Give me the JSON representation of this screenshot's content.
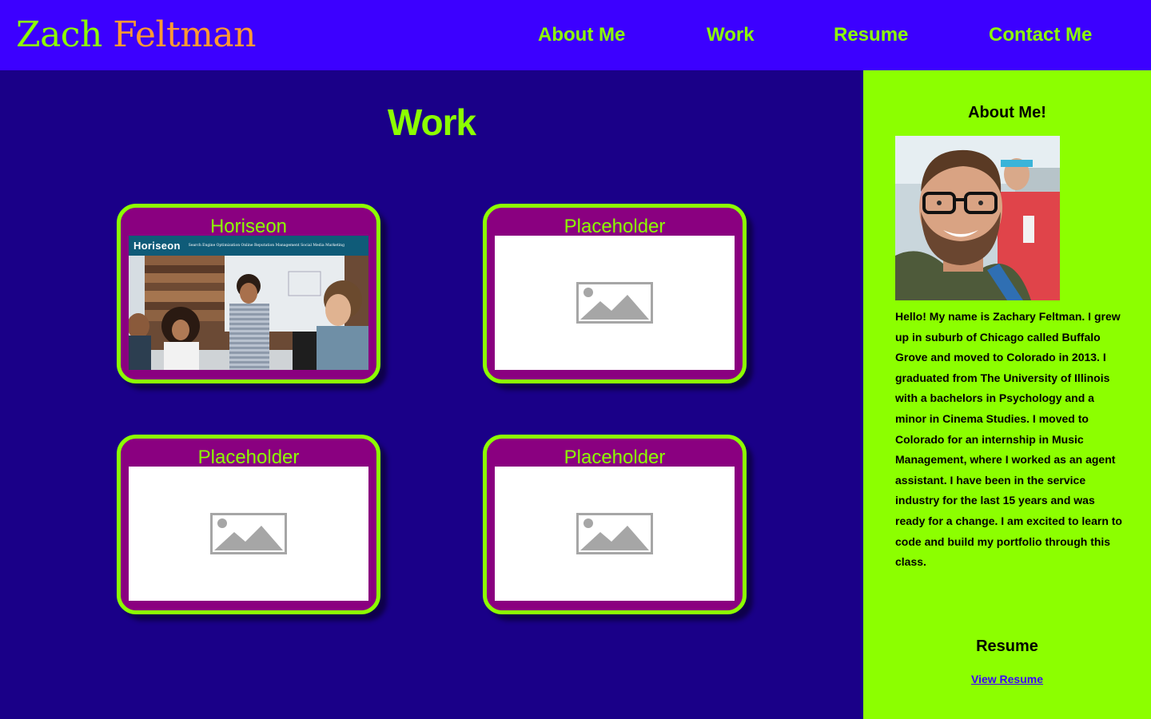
{
  "header": {
    "logo_first": "Zach",
    "logo_last": "Feltman",
    "nav": {
      "about": "About Me",
      "work": "Work",
      "resume": "Resume",
      "contact": "Contact Me"
    }
  },
  "main": {
    "title": "Work",
    "cards": [
      {
        "title": "Horiseon",
        "image": "horiseon-screenshot"
      },
      {
        "title": "Placeholder",
        "image": "image-placeholder-icon"
      },
      {
        "title": "Placeholder",
        "image": "image-placeholder-icon"
      },
      {
        "title": "Placeholder",
        "image": "image-placeholder-icon"
      }
    ],
    "horiseon_preview": {
      "brand": "Horiseon",
      "nav_text": "Search Engine Optimization      Online Reputation Management      Social Media Marketing"
    }
  },
  "sidebar": {
    "about_heading": "About Me!",
    "bio": "Hello! My name is Zachary Feltman. I grew up in suburb of Chicago called Buffalo Grove and moved to Colorado in 2013. I graduated from The University of Illinois with a bachelors in Psychology and a minor in Cinema Studies. I moved to Colorado for an internship in Music Management, where I worked as an agent assistant. I have been in the service industry for the last 15 years and was ready for a change. I am excited to learn to code and build my portfolio through this class.",
    "resume_heading": "Resume",
    "resume_link": "View Resume"
  },
  "colors": {
    "header_bg": "#3c00ff",
    "main_bg": "#1a0088",
    "accent": "#8cff00",
    "logo_last": "#ff9933",
    "card_bg": "#8a0080",
    "sidebar_bg": "#8cff00",
    "link": "#3c00ff"
  }
}
